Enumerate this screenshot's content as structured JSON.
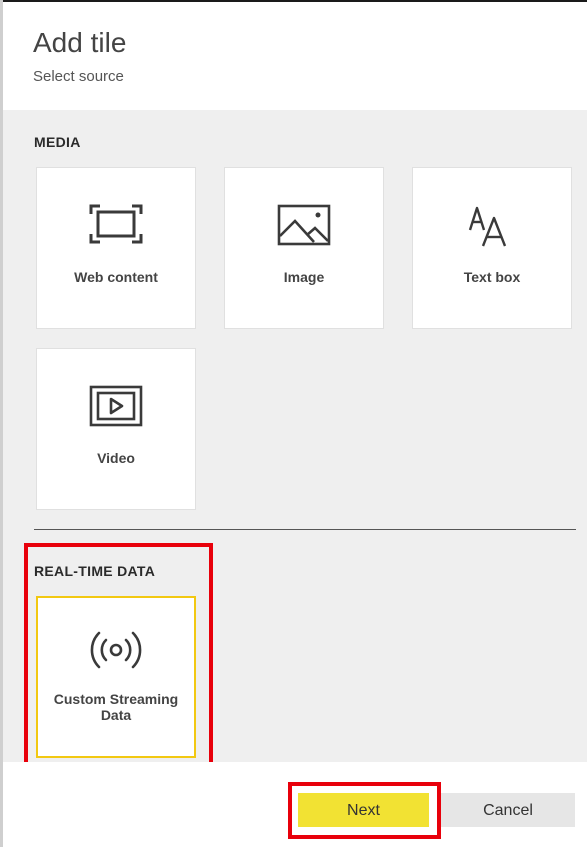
{
  "header": {
    "title": "Add tile",
    "subtitle": "Select source"
  },
  "media": {
    "section_title": "MEDIA",
    "tiles": [
      {
        "label": "Web content",
        "icon": "web-content-icon"
      },
      {
        "label": "Image",
        "icon": "image-icon"
      },
      {
        "label": "Text box",
        "icon": "text-box-icon"
      },
      {
        "label": "Video",
        "icon": "video-icon"
      }
    ]
  },
  "realtime": {
    "section_title": "REAL-TIME DATA",
    "tiles": [
      {
        "label": "Custom Streaming Data",
        "icon": "streaming-broadcast-icon",
        "selected": true
      }
    ]
  },
  "footer": {
    "next_label": "Next",
    "cancel_label": "Cancel"
  },
  "colors": {
    "accent_selected": "#f2c811",
    "next_button": "#f2e233",
    "highlight": "#e8000b"
  }
}
